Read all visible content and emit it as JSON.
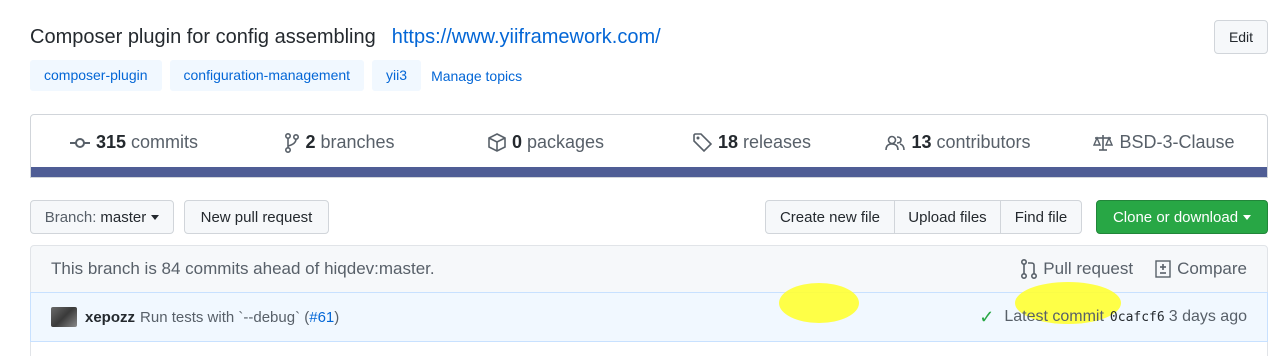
{
  "repo": {
    "description": "Composer plugin for config assembling",
    "website": "https://www.yiiframework.com/",
    "edit_label": "Edit"
  },
  "topics": [
    "composer-plugin",
    "configuration-management",
    "yii3"
  ],
  "manage_topics_label": "Manage topics",
  "stats": {
    "commits_count": "315",
    "commits_label": "commits",
    "branches_count": "2",
    "branches_label": "branches",
    "packages_count": "0",
    "packages_label": "packages",
    "releases_count": "18",
    "releases_label": "releases",
    "contributors_count": "13",
    "contributors_label": "contributors",
    "license": "BSD-3-Clause"
  },
  "language_bar_color": "#4f5d95",
  "toolbar": {
    "branch_prefix": "Branch:",
    "branch_name": "master",
    "new_pull_request": "New pull request",
    "create_new_file": "Create new file",
    "upload_files": "Upload files",
    "find_file": "Find file",
    "clone_or_download": "Clone or download"
  },
  "branch_status": {
    "text": "This branch is 84 commits ahead of hiqdev:master.",
    "pull_request": "Pull request",
    "compare": "Compare"
  },
  "latest_commit": {
    "author": "xepozz",
    "message": "Run tests with `--debug` (",
    "pr_link": "#61",
    "message_end": ")",
    "latest_label": "Latest commit",
    "sha": "0cafcf6",
    "time": "3 days ago",
    "status": "success"
  },
  "highlight_color": "#ffff33"
}
